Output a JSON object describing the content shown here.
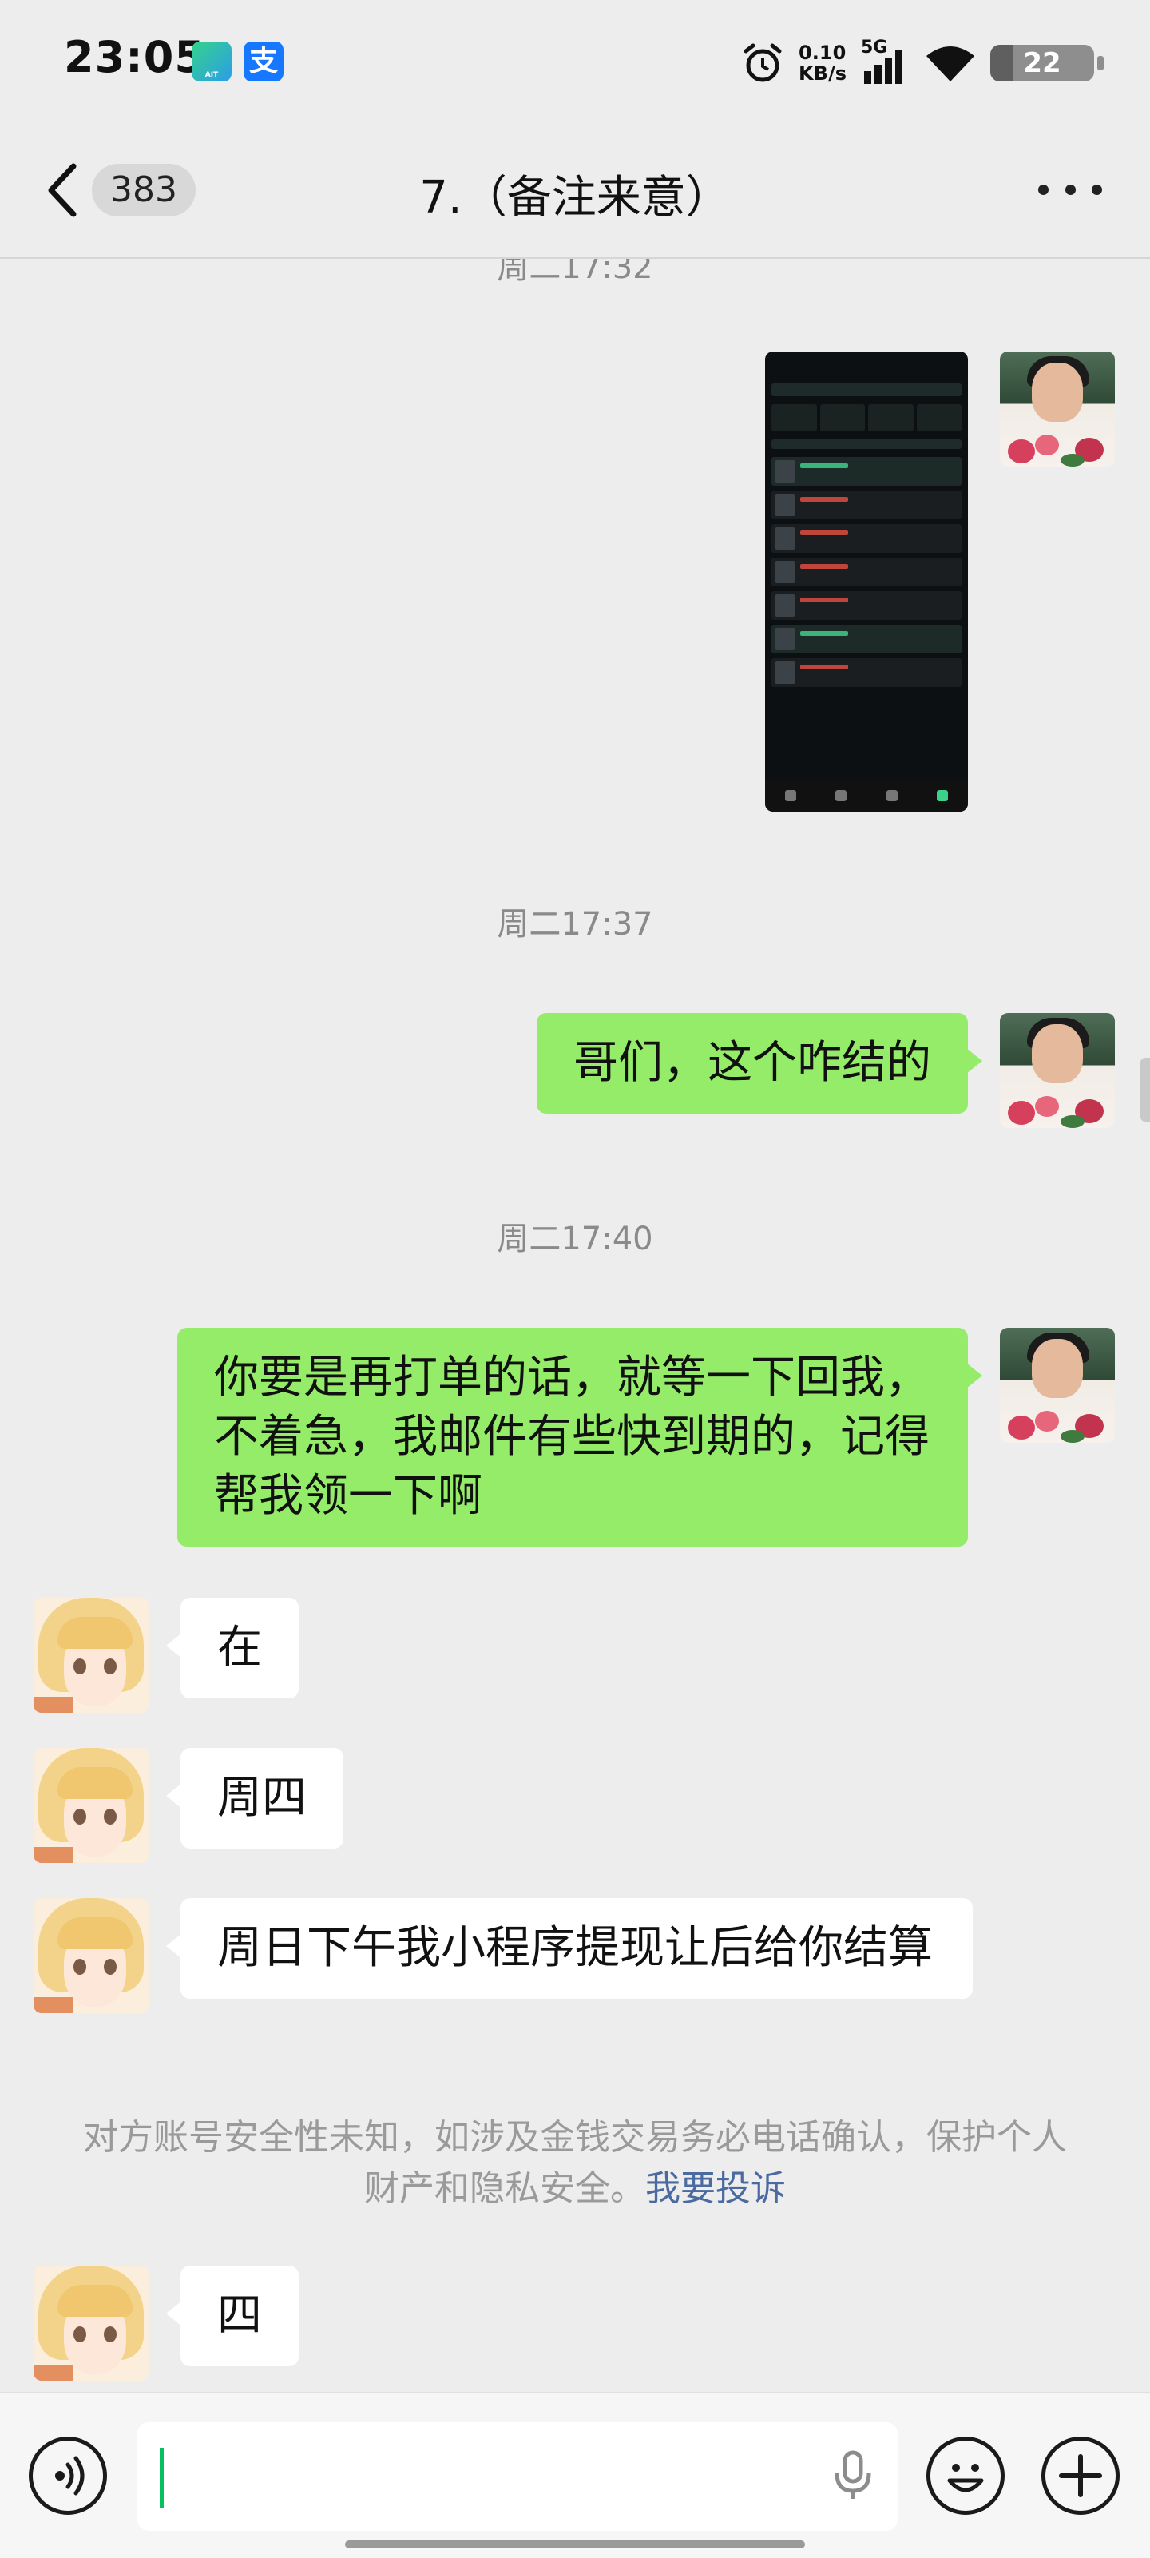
{
  "status_bar": {
    "time": "23:05",
    "app1_label": "AIT",
    "app2_label": "支",
    "net_speed_value": "0.10",
    "net_speed_unit": "KB/s",
    "network_type": "5G",
    "battery_level": "22",
    "icons": [
      "alarm-icon",
      "signal-icon",
      "wifi-icon",
      "battery-icon"
    ]
  },
  "header": {
    "unread_count": "383",
    "title": "7.（备注来意）"
  },
  "messages": {
    "time_partial": "周二17:32",
    "time_1": "周二17:37",
    "text_1": "哥们，这个咋结的",
    "time_2": "周二17:40",
    "text_2": "你要是再打单的话，就等一下回我，不着急，我邮件有些快到期的，记得帮我领一下啊",
    "reply_1": "在",
    "reply_2": "周四",
    "reply_3": "周日下午我小程序提现让后给你结算",
    "notice_text": "对方账号安全性未知，如涉及金钱交易务必电话确认，保护个人财产和隐私安全。",
    "notice_link": "我要投诉",
    "reply_4": "四"
  },
  "input_bar": {
    "icons": [
      "voice-icon",
      "mic-icon",
      "emoji-icon",
      "plus-icon"
    ]
  },
  "colors": {
    "sent_bubble": "#95ec69",
    "received_bubble": "#ffffff",
    "background": "#ededed",
    "link": "#4a6aa0"
  }
}
